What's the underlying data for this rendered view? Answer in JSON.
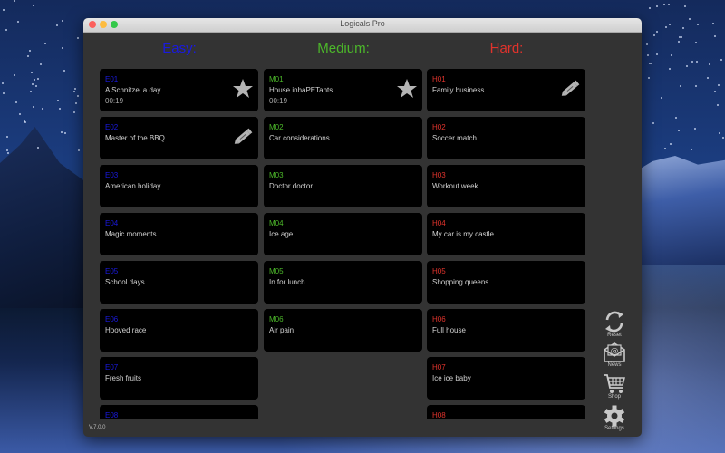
{
  "window": {
    "title": "Logicals Pro"
  },
  "columns": [
    {
      "label": "Easy:",
      "color": "#1a1adf"
    },
    {
      "label": "Medium:",
      "color": "#4cb82a"
    },
    {
      "label": "Hard:",
      "color": "#e0332c"
    }
  ],
  "easy": [
    {
      "code": "E01",
      "name": "A Schnitzel a day...",
      "time": "00:19",
      "badge": "star-icon"
    },
    {
      "code": "E02",
      "name": "Master of the BBQ",
      "time": "",
      "badge": "pencil-icon"
    },
    {
      "code": "E03",
      "name": "American holiday",
      "time": "",
      "badge": ""
    },
    {
      "code": "E04",
      "name": "Magic moments",
      "time": "",
      "badge": ""
    },
    {
      "code": "E05",
      "name": "School days",
      "time": "",
      "badge": ""
    },
    {
      "code": "E06",
      "name": "Hooved race",
      "time": "",
      "badge": ""
    },
    {
      "code": "E07",
      "name": "Fresh fruits",
      "time": "",
      "badge": ""
    },
    {
      "code": "E08",
      "name": "",
      "time": "",
      "badge": ""
    }
  ],
  "medium": [
    {
      "code": "M01",
      "name": "House inhaPETants",
      "time": "00:19",
      "badge": "star-icon"
    },
    {
      "code": "M02",
      "name": "Car considerations",
      "time": "",
      "badge": ""
    },
    {
      "code": "M03",
      "name": "Doctor doctor",
      "time": "",
      "badge": ""
    },
    {
      "code": "M04",
      "name": "Ice age",
      "time": "",
      "badge": ""
    },
    {
      "code": "M05",
      "name": "In for lunch",
      "time": "",
      "badge": ""
    },
    {
      "code": "M06",
      "name": "Air pain",
      "time": "",
      "badge": ""
    }
  ],
  "hard": [
    {
      "code": "H01",
      "name": "Family business",
      "time": "",
      "badge": "pencil-icon"
    },
    {
      "code": "H02",
      "name": "Soccer match",
      "time": "",
      "badge": ""
    },
    {
      "code": "H03",
      "name": "Workout week",
      "time": "",
      "badge": ""
    },
    {
      "code": "H04",
      "name": "My car is my castle",
      "time": "",
      "badge": ""
    },
    {
      "code": "H05",
      "name": "Shopping queens",
      "time": "",
      "badge": ""
    },
    {
      "code": "H06",
      "name": "Full house",
      "time": "",
      "badge": ""
    },
    {
      "code": "H07",
      "name": "Ice ice baby",
      "time": "",
      "badge": ""
    },
    {
      "code": "H08",
      "name": "",
      "time": "",
      "badge": ""
    }
  ],
  "sidebar": [
    {
      "label": "Reset",
      "icon": "reset-icon"
    },
    {
      "label": "News",
      "icon": "news-icon"
    },
    {
      "label": "Shop",
      "icon": "shop-icon"
    },
    {
      "label": "Settings",
      "icon": "settings-icon"
    }
  ],
  "version": "V.7.0.0",
  "colors": {
    "window_bg": "#333333",
    "card_bg": "#000000",
    "badge": "#b4b4b4"
  }
}
